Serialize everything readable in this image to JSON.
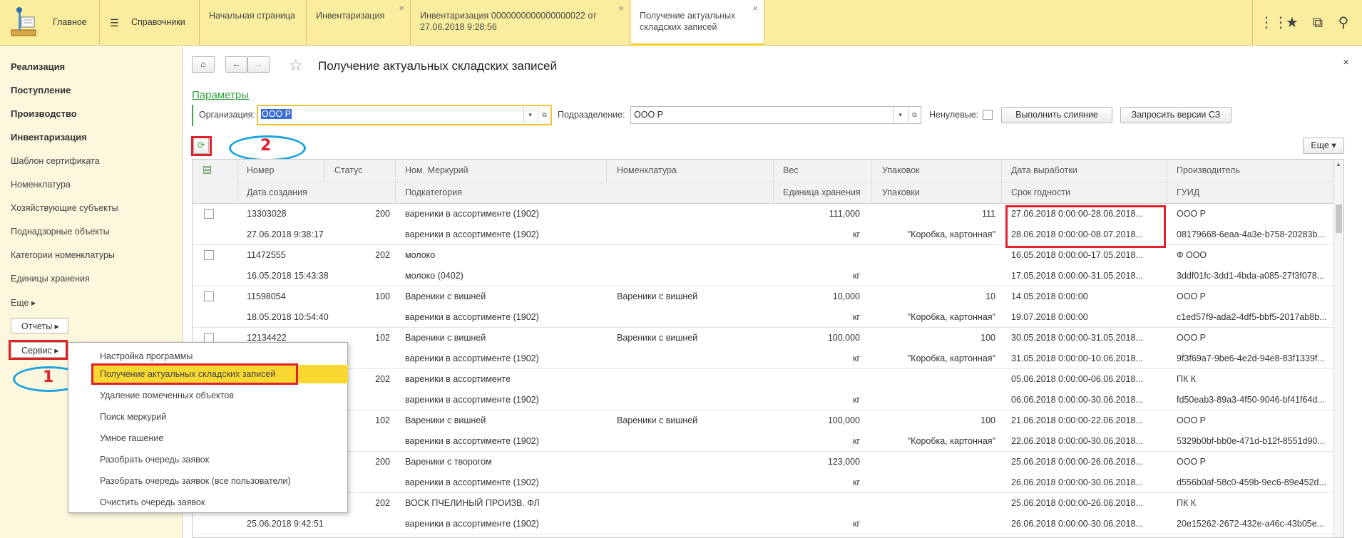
{
  "top": {
    "home_label": "Главное",
    "ref_label": "Справочники",
    "tabs": [
      {
        "label": "Начальная страница"
      },
      {
        "label": "Инвентаризация"
      },
      {
        "label": "Инвентаризация 0000000000000000022 от 27.06.2018 9:28:56"
      },
      {
        "label": "Получение актуальных складских записей"
      }
    ],
    "close_glyph": "×"
  },
  "sidebar": {
    "items": [
      "Реализация",
      "Поступление",
      "Производство",
      "Инвентаризация",
      "Шаблон сертификата",
      "Номенклатура",
      "Хозяйствующие субъекты",
      "Поднадзорные объекты",
      "Категории номенклатуры",
      "Единицы хранения",
      "Еще ▸"
    ],
    "reports": "Отчеты ▸",
    "service": "Сервис ▸"
  },
  "menu": {
    "items": [
      "Настройка программы",
      "Получение актуальных складских записей",
      "Удаление помеченных объектов",
      "Поиск меркурий",
      "Умное гашение",
      "Разобрать очередь заявок",
      "Разобрать очередь заявок (все пользователи)",
      "Очистить очередь заявок"
    ]
  },
  "annotations": {
    "n1": "1",
    "n2": "2"
  },
  "form": {
    "title": "Получение актуальных складских записей",
    "close": "×",
    "params": "Параметры",
    "org_label": "Организация:",
    "org_value": "ООО Р",
    "div_label": "Подразделение:",
    "div_value": "ООО Р",
    "nonzero_label": "Ненулевые:",
    "merge_btn": "Выполнить слияние",
    "request_btn": "Запросить версии СЗ",
    "more_btn": "Еще ▾"
  },
  "grid": {
    "headers1": [
      "Номер",
      "Статус",
      "Ном. Меркурий",
      "Номенклатура",
      "Вес",
      "Упаковок",
      "Дата выработки",
      "Производитель"
    ],
    "headers2": [
      "Дата создания",
      "Подкатегория",
      "Единица хранения",
      "Упаковки",
      "Срок годности",
      "ГУИД"
    ],
    "rows": [
      {
        "num": "13303028",
        "status": "200",
        "merc": "вареники в ассортименте (1902)",
        "nom": "",
        "weight": "111,000",
        "packs": "111",
        "prod_date": "27.06.2018 0:00:00-28.06.2018...",
        "maker": "ООО Р",
        "created": "27.06.2018 9:38:17",
        "subcat": "вареники в ассортименте (1902)",
        "unit": "кг",
        "pack_type": "\"Коробка, картонная\"",
        "expiry": "28.06.2018 0:00:00-08.07.2018...",
        "guid": "08179668-6eaa-4a3e-b758-20283b..."
      },
      {
        "num": "11472555",
        "status": "202",
        "merc": "молоко",
        "nom": "",
        "weight": "",
        "packs": "",
        "prod_date": "16.05.2018 0:00:00-17.05.2018...",
        "maker": "Ф          ООО",
        "created": "16.05.2018 15:43:38",
        "subcat": "молоко (0402)",
        "unit": "кг",
        "pack_type": "",
        "expiry": "17.05.2018 0:00:00-31.05.2018...",
        "guid": "3ddf01fc-3dd1-4bda-a085-27f3f078..."
      },
      {
        "num": "11598054",
        "status": "100",
        "merc": "Вареники с вишней",
        "nom": "Вареники с вишней",
        "weight": "10,000",
        "packs": "10",
        "prod_date": "14.05.2018 0:00:00",
        "maker": "ООО Р",
        "created": "18.05.2018 10:54:40",
        "subcat": "вареники в ассортименте (1902)",
        "unit": "кг",
        "pack_type": "\"Коробка, картонная\"",
        "expiry": "19.07.2018 0:00:00",
        "guid": "c1ed57f9-ada2-4df5-bbf5-2017ab8b..."
      },
      {
        "num": "12134422",
        "status": "102",
        "merc": "Вареники с вишней",
        "nom": "Вареники с вишней",
        "weight": "100,000",
        "packs": "100",
        "prod_date": "30.05.2018 0:00:00-31.05.2018...",
        "maker": "ООО Р",
        "created": "",
        "subcat": "вареники в ассортименте (1902)",
        "unit": "кг",
        "pack_type": "\"Коробка, картонная\"",
        "expiry": "31.05.2018 0:00:00-10.06.2018...",
        "guid": "9f3f69a7-9be6-4e2d-94e8-83f1339f..."
      },
      {
        "num": "",
        "status": "202",
        "merc": "вареники в ассортименте",
        "nom": "",
        "weight": "",
        "packs": "",
        "prod_date": "05.06.2018 0:00:00-06.06.2018...",
        "maker": "ПК К",
        "created": "",
        "subcat": "вареники в ассортименте (1902)",
        "unit": "кг",
        "pack_type": "",
        "expiry": "06.06.2018 0:00:00-30.06.2018...",
        "guid": "fd50eab3-89a3-4f50-9046-bf41f64d..."
      },
      {
        "num": "",
        "status": "102",
        "merc": "Вареники с вишней",
        "nom": "Вареники с вишней",
        "weight": "100,000",
        "packs": "100",
        "prod_date": "21.06.2018 0:00:00-22.06.2018...",
        "maker": "ООО Р",
        "created": "",
        "subcat": "вареники в ассортименте (1902)",
        "unit": "кг",
        "pack_type": "\"Коробка, картонная\"",
        "expiry": "22.06.2018 0:00:00-30.06.2018...",
        "guid": "5329b0bf-bb0e-471d-b12f-8551d90..."
      },
      {
        "num": "",
        "status": "200",
        "merc": "Вареники с творогом",
        "nom": "",
        "weight": "123,000",
        "packs": "",
        "prod_date": "25.06.2018 0:00:00-26.06.2018...",
        "maker": "ООО Р",
        "created": "",
        "subcat": "вареники в ассортименте (1902)",
        "unit": "кг",
        "pack_type": "",
        "expiry": "26.06.2018 0:00:00-30.06.2018...",
        "guid": "d556b0af-58c0-459b-9ec6-89e452d..."
      },
      {
        "num": "",
        "status": "202",
        "merc": "ВОСК ПЧЕЛИНЫЙ ПРОИЗВ. ФЛ",
        "nom": "",
        "weight": "",
        "packs": "",
        "prod_date": "25.06.2018 0:00:00-26.06.2018...",
        "maker": "ПК К",
        "created": "25.06.2018 9:42:51",
        "subcat": "вареники в ассортименте (1902)",
        "unit": "кг",
        "pack_type": "",
        "expiry": "26.06.2018 0:00:00-30.06.2018...",
        "guid": "20e15262-2672-432e-a46c-43b05e..."
      }
    ]
  }
}
